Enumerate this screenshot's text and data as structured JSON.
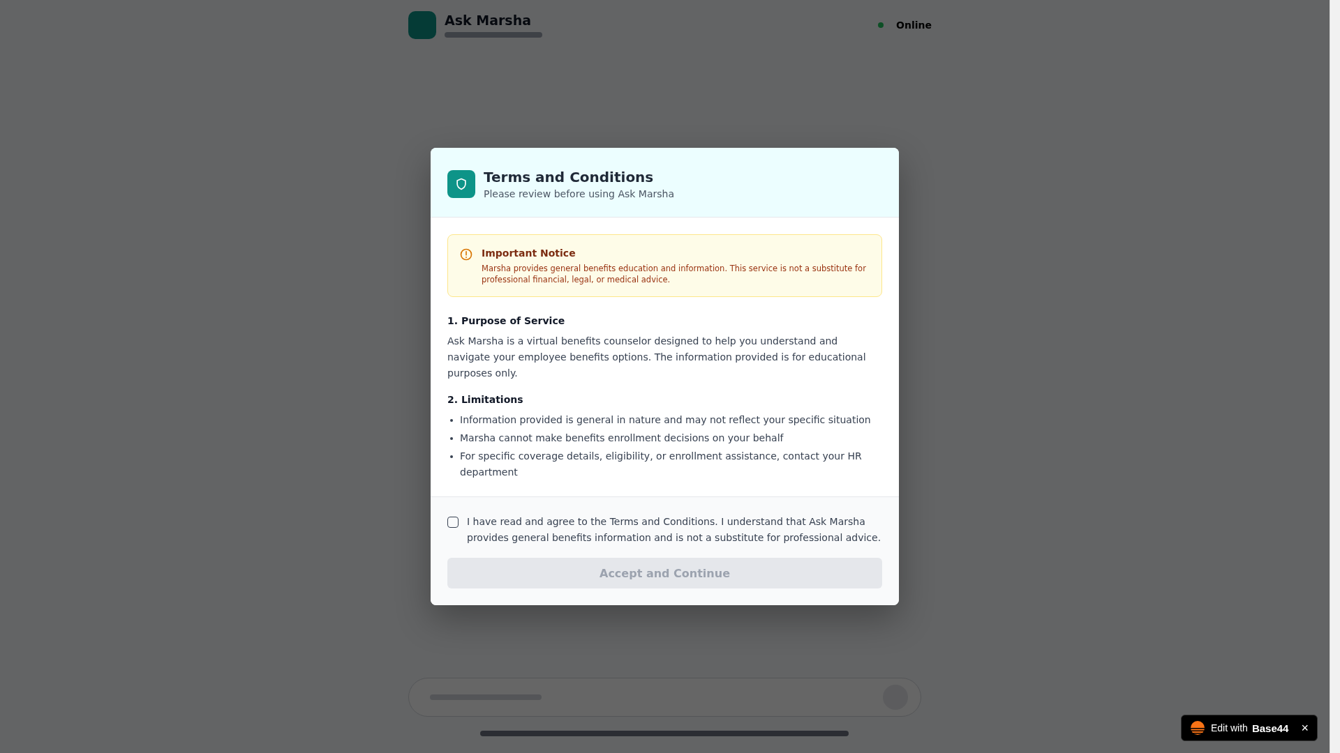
{
  "app_header": {
    "title": "Ask Marsha",
    "status": "Online"
  },
  "modal": {
    "title": "Terms and Conditions",
    "subtitle": "Please review before using Ask Marsha",
    "notice": {
      "title": "Important Notice",
      "text": "Marsha provides general benefits education and information. This service is not a substitute for professional financial, legal, or medical advice."
    },
    "sections": [
      {
        "kind": "paragraph",
        "heading": "1. Purpose of Service",
        "text": "Ask Marsha is a virtual benefits counselor designed to help you understand and navigate your employee benefits options. The information provided is for educational purposes only."
      },
      {
        "kind": "list",
        "heading": "2. Limitations",
        "items": [
          "Information provided is general in nature and may not reflect your specific situation",
          "Marsha cannot make benefits enrollment decisions on your behalf",
          "For specific coverage details, eligibility, or enrollment assistance, contact your HR department"
        ]
      }
    ],
    "agreement": {
      "label": "I have read and agree to the Terms and Conditions. I understand that Ask Marsha provides general benefits information and is not a substitute for professional advice.",
      "checked": false
    },
    "button": {
      "label": "Accept and Continue",
      "disabled": true
    }
  },
  "badge": {
    "prefix": "Edit with",
    "brand": "Base44",
    "close": "×"
  }
}
